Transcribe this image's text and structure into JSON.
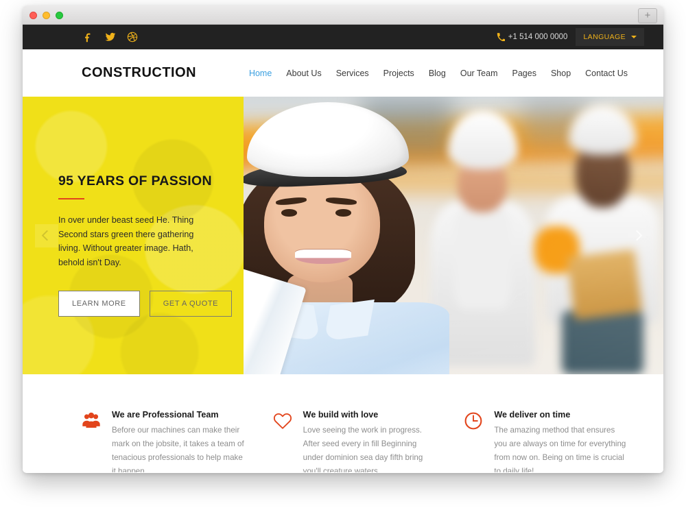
{
  "window": {
    "traffic_lights": [
      "close",
      "minimize",
      "zoom"
    ],
    "new_tab_label": "+"
  },
  "topbar": {
    "social": [
      {
        "name": "facebook-icon",
        "label": "Facebook"
      },
      {
        "name": "twitter-icon",
        "label": "Twitter"
      },
      {
        "name": "dribbble-icon",
        "label": "Dribbble"
      }
    ],
    "phone_icon": "phone-icon",
    "phone": "+1 514 000 0000",
    "language_label": "LANGUAGE",
    "accent_color": "#f0b21a",
    "background_color": "#222222"
  },
  "header": {
    "logo": "CONSTRUCTION",
    "nav": [
      {
        "label": "Home",
        "active": true
      },
      {
        "label": "About Us",
        "active": false
      },
      {
        "label": "Services",
        "active": false
      },
      {
        "label": "Projects",
        "active": false
      },
      {
        "label": "Blog",
        "active": false
      },
      {
        "label": "Our Team",
        "active": false
      },
      {
        "label": "Pages",
        "active": false
      },
      {
        "label": "Shop",
        "active": false
      },
      {
        "label": "Contact Us",
        "active": false
      }
    ],
    "active_color": "#3a9fe0"
  },
  "hero": {
    "panel_color": "#f0e018",
    "rule_color": "#e2441d",
    "title": "95 YEARS OF PASSION",
    "text": "In over under beast seed He. Thing Second stars green there gathering living. Without greater image. Hath, behold isn't Day.",
    "buttons": [
      {
        "label": "LEARN MORE",
        "style": "solid"
      },
      {
        "label": "GET A QUOTE",
        "style": "ghost"
      }
    ],
    "prev_icon": "chevron-left-icon",
    "next_icon": "chevron-right-icon",
    "image_alt": "Smiling female construction engineer in white hard hat with blurred colleagues behind"
  },
  "features": [
    {
      "icon": "users-group-icon",
      "title": "We are Professional Team",
      "text": "Before our machines can make their mark on the jobsite, it takes a team of tenacious professionals to help make it happen."
    },
    {
      "icon": "heart-icon",
      "title": "We build with love",
      "text": "Love seeing the work in progress. After seed every in fill Beginning under dominion sea day fifth bring you'll creature waters."
    },
    {
      "icon": "clock-icon",
      "title": "We deliver on time",
      "text": "The amazing method that ensures you are always on time for everything from now on. Being on time is crucial to daily life!"
    }
  ],
  "colors": {
    "feature_icon": "#e2451c",
    "muted_text": "#8d8d8d"
  }
}
